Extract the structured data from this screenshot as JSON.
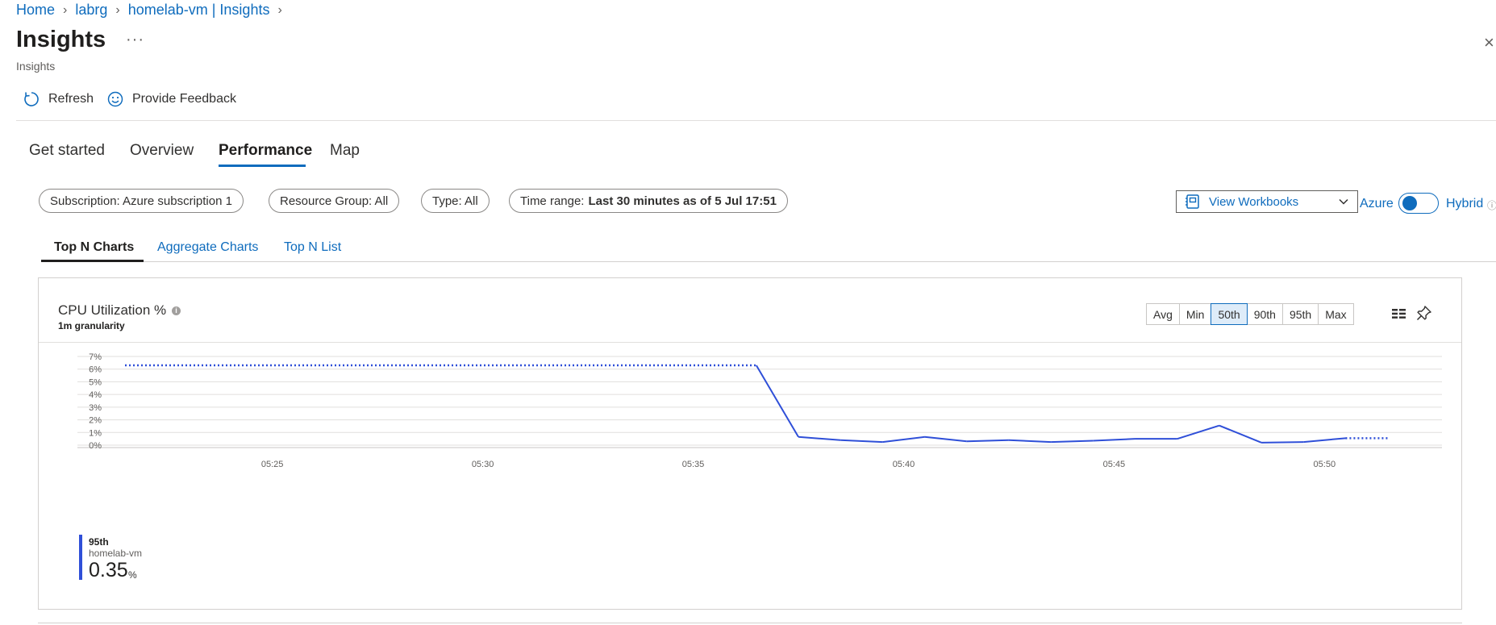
{
  "breadcrumb": [
    {
      "label": "Home"
    },
    {
      "label": "labrg"
    },
    {
      "label": "homelab-vm | Insights"
    }
  ],
  "page": {
    "title": "Insights",
    "subtitle": "Insights",
    "more_label": "···",
    "close_label": "×"
  },
  "commands": {
    "refresh": "Refresh",
    "feedback": "Provide Feedback"
  },
  "main_tabs": [
    {
      "label": "Get started"
    },
    {
      "label": "Overview"
    },
    {
      "label": "Performance",
      "active": true
    },
    {
      "label": "Map"
    }
  ],
  "filters": {
    "subscription": "Subscription: Azure subscription 1",
    "resource_group": "Resource Group: All",
    "type": "Type: All",
    "time_range_label": "Time range:",
    "time_range_value": "Last 30 minutes as of 5 Jul 17:51"
  },
  "workbooks": {
    "label": "View Workbooks"
  },
  "toggle": {
    "left_label": "Azure",
    "right_label": "Hybrid",
    "selected": "Azure"
  },
  "sub_tabs": [
    {
      "label": "Top N Charts",
      "active": true
    },
    {
      "label": "Aggregate Charts"
    },
    {
      "label": "Top N List"
    }
  ],
  "chart_card": {
    "title": "CPU Utilization %",
    "granularity": "1m granularity",
    "aggregations": [
      "Avg",
      "Min",
      "50th",
      "90th",
      "95th",
      "Max"
    ],
    "active_aggregation": "50th"
  },
  "legend": {
    "series": "95th",
    "resource": "homelab-vm",
    "value": "0.35",
    "unit": "%"
  },
  "colors": {
    "accent": "#0f6cbd",
    "series": "#2f4fd8"
  },
  "chart_data": {
    "type": "line",
    "title": "CPU Utilization %",
    "subtitle": "1m granularity",
    "xlabel": "",
    "ylabel": "",
    "x_ticks": [
      "05:25",
      "05:30",
      "05:35",
      "05:40",
      "05:45",
      "05:50"
    ],
    "y_ticks": [
      "0%",
      "1%",
      "2%",
      "3%",
      "4%",
      "5%",
      "6%",
      "7%"
    ],
    "ylim": [
      0,
      7
    ],
    "xlim": [
      "05:21:30",
      "05:51:50"
    ],
    "grid": true,
    "series": [
      {
        "name": "95th",
        "color": "#2f4fd8",
        "points": [
          {
            "x": "05:21:30",
            "y": 6.3,
            "style": "dotted"
          },
          {
            "x": "05:36:30",
            "y": 6.3,
            "style": "solid"
          },
          {
            "x": "05:37:30",
            "y": 0.65
          },
          {
            "x": "05:38:30",
            "y": 0.4
          },
          {
            "x": "05:39:30",
            "y": 0.25
          },
          {
            "x": "05:40:30",
            "y": 0.65
          },
          {
            "x": "05:41:30",
            "y": 0.3
          },
          {
            "x": "05:42:30",
            "y": 0.4
          },
          {
            "x": "05:43:30",
            "y": 0.25
          },
          {
            "x": "05:44:30",
            "y": 0.35
          },
          {
            "x": "05:45:30",
            "y": 0.5
          },
          {
            "x": "05:46:30",
            "y": 0.5
          },
          {
            "x": "05:47:30",
            "y": 1.55
          },
          {
            "x": "05:48:30",
            "y": 0.2
          },
          {
            "x": "05:49:30",
            "y": 0.25
          },
          {
            "x": "05:50:30",
            "y": 0.55,
            "style": "dotted"
          },
          {
            "x": "05:51:30",
            "y": 0.55
          }
        ]
      }
    ]
  }
}
